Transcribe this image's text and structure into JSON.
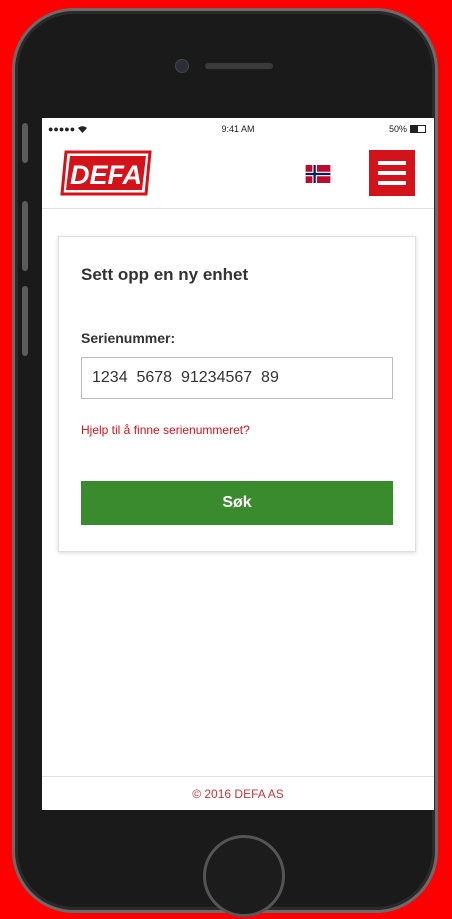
{
  "status_bar": {
    "signal": "●●●●● ",
    "time": "9:41 AM",
    "battery_text": "50%",
    "battery_level": 0.5
  },
  "header": {
    "logo_text": "DEFA",
    "language_flag": "norway-flag-icon",
    "menu_icon": "hamburger-menu-icon"
  },
  "form": {
    "title": "Sett opp en ny enhet",
    "serial_label": "Serienummer:",
    "serial_value": "1234  5678  91234567  89",
    "help_link": "Hjelp til å finne serienummeret?",
    "search_button": "Søk"
  },
  "footer": {
    "copyright": "© 2016 DEFA AS"
  },
  "colors": {
    "brand_red": "#d3121a",
    "button_green": "#3a8a2e",
    "background": "#ff0000"
  }
}
